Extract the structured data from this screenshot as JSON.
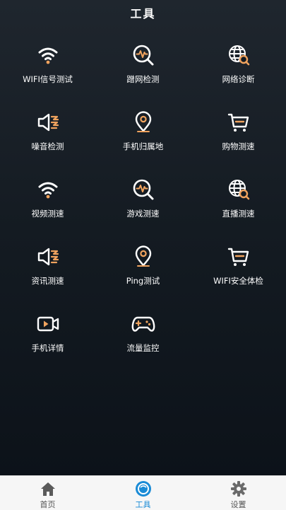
{
  "header": {
    "title": "工具"
  },
  "tools": [
    {
      "label": "WIFI信号测试",
      "icon": "wifi-icon"
    },
    {
      "label": "蹭网检测",
      "icon": "search-pulse-icon"
    },
    {
      "label": "网络诊断",
      "icon": "globe-search-icon"
    },
    {
      "label": "噪音检测",
      "icon": "speaker-noise-icon"
    },
    {
      "label": "手机归属地",
      "icon": "location-pin-icon"
    },
    {
      "label": "购物测速",
      "icon": "shopping-cart-icon"
    },
    {
      "label": "视频测速",
      "icon": "wifi-icon"
    },
    {
      "label": "游戏测速",
      "icon": "search-pulse-icon"
    },
    {
      "label": "直播测速",
      "icon": "globe-search-icon"
    },
    {
      "label": "资讯测速",
      "icon": "speaker-noise-icon"
    },
    {
      "label": "Ping测试",
      "icon": "location-pin-icon"
    },
    {
      "label": "WIFI安全体检",
      "icon": "shopping-cart-icon"
    },
    {
      "label": "手机详情",
      "icon": "video-camera-icon"
    },
    {
      "label": "流量监控",
      "icon": "gamepad-icon"
    }
  ],
  "tabbar": {
    "items": [
      {
        "label": "首页",
        "icon": "home-icon",
        "active": false
      },
      {
        "label": "工具",
        "icon": "tools-icon",
        "active": true
      },
      {
        "label": "设置",
        "icon": "gear-icon",
        "active": false
      }
    ]
  },
  "colors": {
    "accent": "#f0a35e",
    "tab_active": "#1a8bd6",
    "background": "#141b22"
  }
}
